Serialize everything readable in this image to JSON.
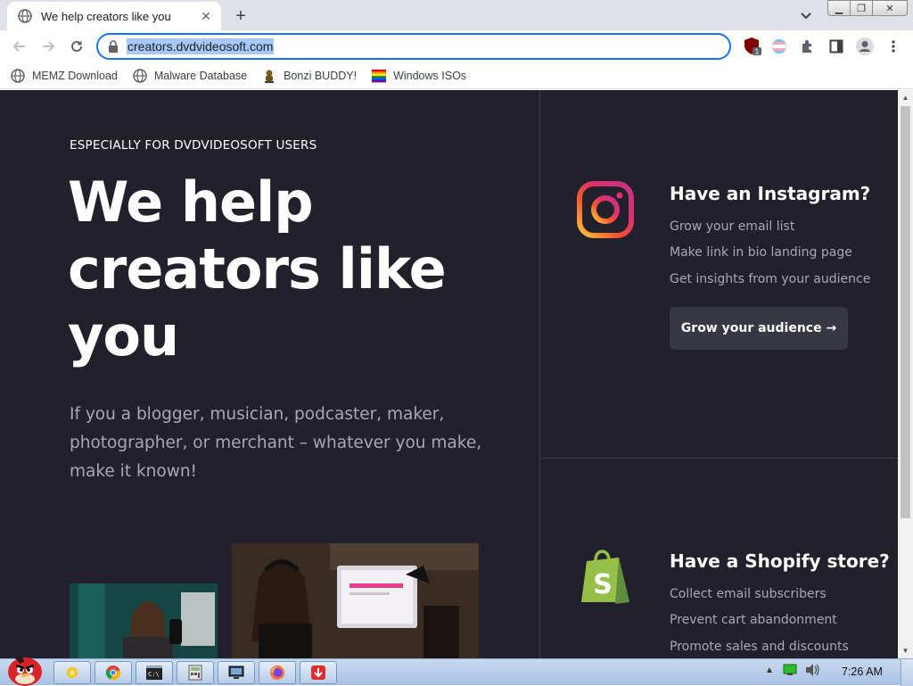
{
  "browser": {
    "tab": {
      "title": "We help creators like you",
      "favicon": "globe-icon"
    },
    "toolbar": {
      "url": "creators.dvdvideosoft.com",
      "extension_badge": "1"
    },
    "bookmarks": [
      {
        "label": "MEMZ Download",
        "icon": "globe-icon"
      },
      {
        "label": "Malware Database",
        "icon": "globe-icon"
      },
      {
        "label": "Bonzi BUDDY!",
        "icon": "bonzi-icon"
      },
      {
        "label": "Windows ISOs",
        "icon": "rainbow-flag-icon"
      }
    ]
  },
  "page": {
    "eyebrow": "ESPECIALLY FOR DVDVIDEOSOFT USERS",
    "headline_1": "We help",
    "headline_2": "creators like",
    "headline_3": "you",
    "lead": "If you a blogger, musician, podcaster, maker, photographer, or merchant – whatever you make, make it known!",
    "instagram": {
      "title": "Have an Instagram?",
      "lines": [
        "Grow your email list",
        "Make link in bio landing page",
        "Get insights from your audience"
      ],
      "cta": "Grow your audience →"
    },
    "shopify": {
      "title": "Have a Shopify store?",
      "lines": [
        "Collect email subscribers",
        "Prevent cart abandonment",
        "Promote sales and discounts"
      ]
    }
  },
  "taskbar": {
    "clock": "7:26 AM"
  },
  "colors": {
    "page_bg": "#22212b",
    "accent": "#1a73e8",
    "muted_text": "#a8a7b3",
    "cta_bg": "#383744"
  }
}
